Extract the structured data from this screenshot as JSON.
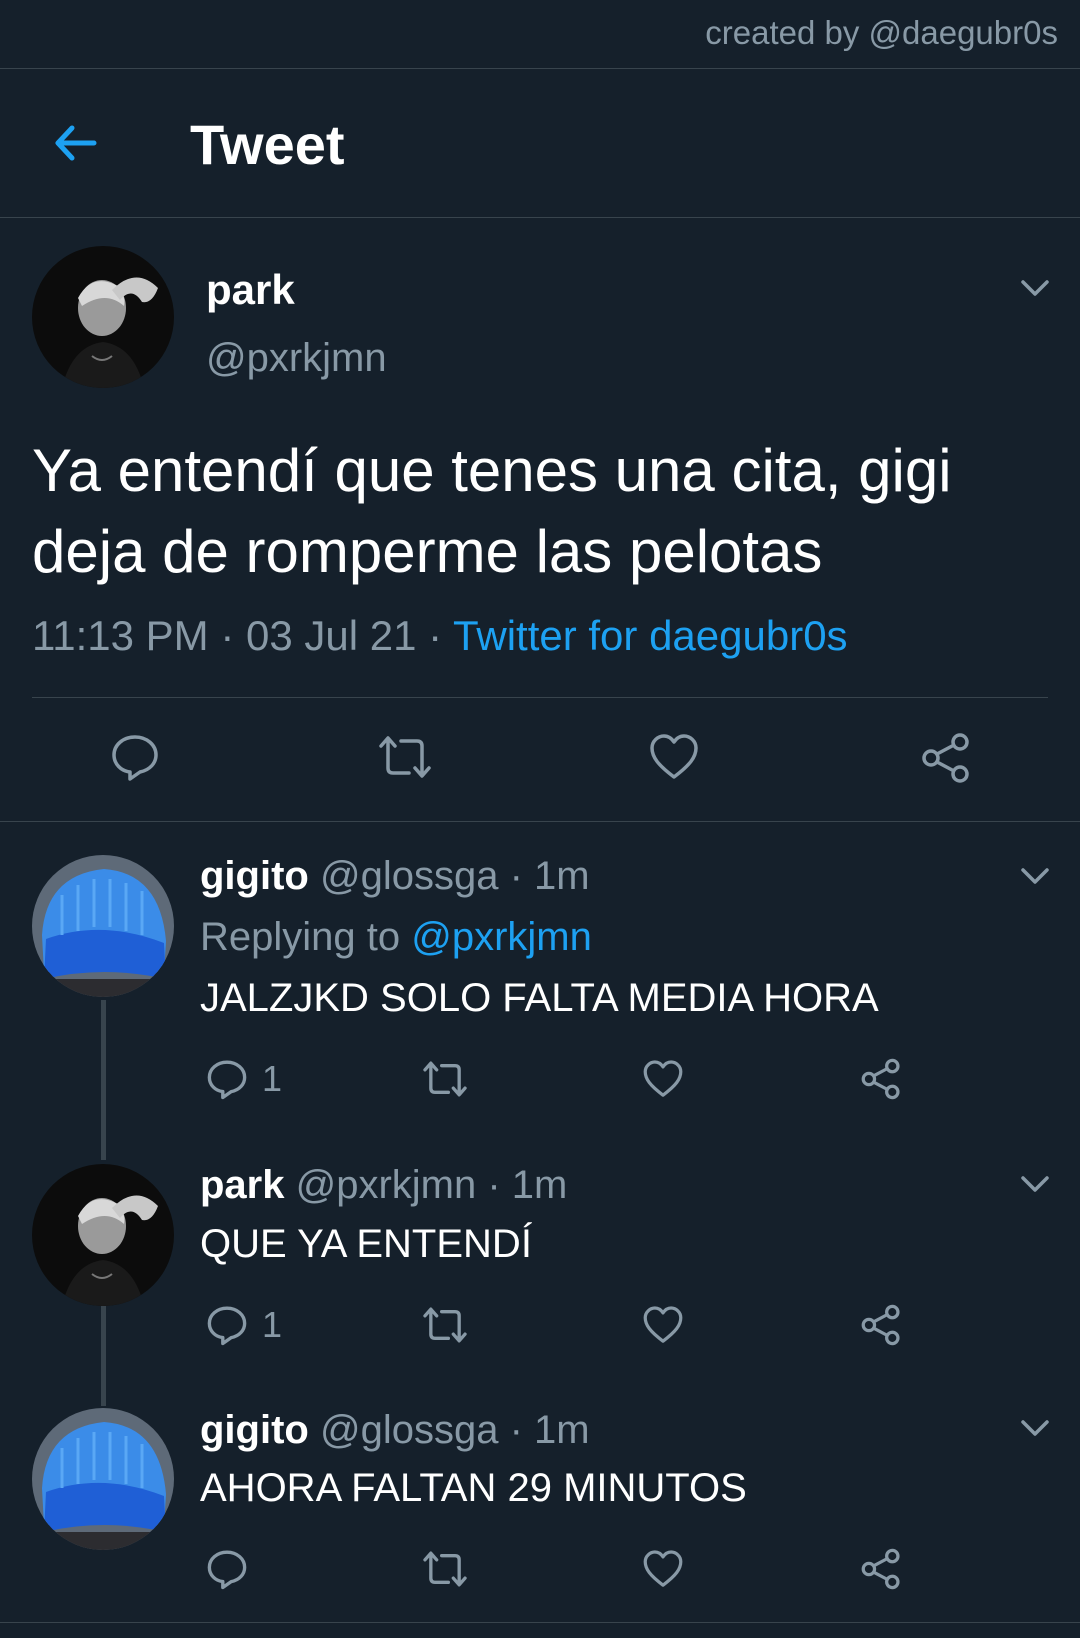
{
  "watermark": "created by @daegubr0s",
  "header": {
    "title": "Tweet",
    "back_icon": "arrow-left-icon"
  },
  "colors": {
    "background": "#15202b",
    "accent": "#1da1f2",
    "muted": "#8899a6",
    "divider": "#38444d"
  },
  "main_tweet": {
    "name": "park",
    "handle": "@pxrkjmn",
    "text": "Ya entendí que tenes una cita, gigi deja de romperme las pelotas",
    "time": "11:13 PM",
    "sep1": " · ",
    "date": "03 Jul 21",
    "sep2": " · ",
    "source": "Twitter for daegubr0s",
    "actions": [
      "reply-icon",
      "retweet-icon",
      "like-icon",
      "share-icon"
    ]
  },
  "replies": [
    {
      "name": "gigito",
      "handle": "@glossga",
      "dot": " · ",
      "time": "1m",
      "replying_label": "Replying to ",
      "replying_to": "@pxrkjmn",
      "text": "JALZJKD SOLO FALTA MEDIA HORA",
      "reply_count": "1"
    },
    {
      "name": "park",
      "handle": "@pxrkjmn",
      "dot": " · ",
      "time": "1m",
      "text": "QUE YA ENTENDÍ",
      "reply_count": "1"
    },
    {
      "name": "gigito",
      "handle": "@glossga",
      "dot": " · ",
      "time": "1m",
      "text": "AHORA FALTAN 29 MINUTOS",
      "reply_count": ""
    }
  ]
}
